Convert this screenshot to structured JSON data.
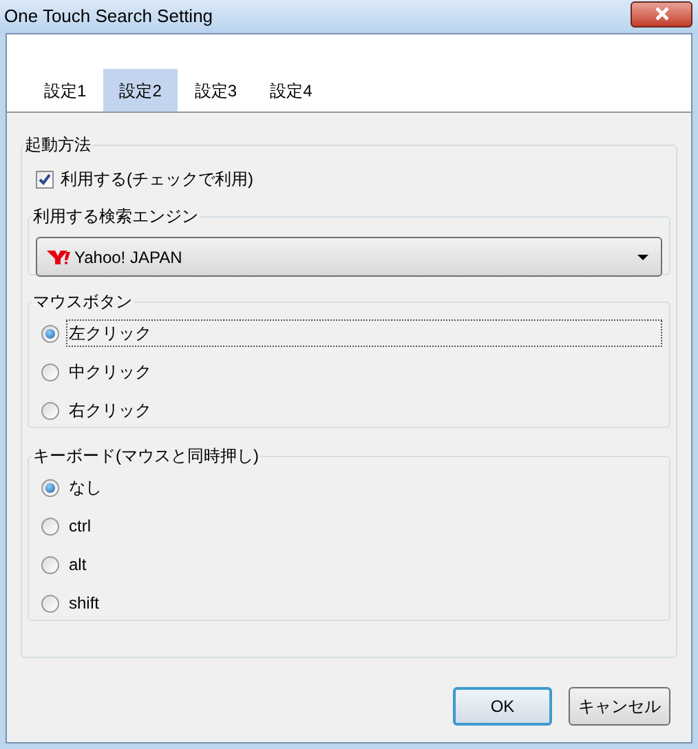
{
  "window": {
    "title": "One Touch Search Setting"
  },
  "tabs": [
    {
      "label": "設定1",
      "selected": false
    },
    {
      "label": "設定2",
      "selected": true
    },
    {
      "label": "設定3",
      "selected": false
    },
    {
      "label": "設定4",
      "selected": false
    }
  ],
  "startup": {
    "title": "起動方法",
    "enable": {
      "label": "利用する(チェックで利用)",
      "checked": true
    },
    "engine": {
      "title": "利用する検索エンジン",
      "value": "Yahoo! JAPAN"
    },
    "mouse": {
      "title": "マウスボタン",
      "options": [
        {
          "label": "左クリック",
          "selected": true,
          "focused": true
        },
        {
          "label": "中クリック",
          "selected": false,
          "focused": false
        },
        {
          "label": "右クリック",
          "selected": false,
          "focused": false
        }
      ]
    },
    "keyboard": {
      "title": "キーボード(マウスと同時押し)",
      "options": [
        {
          "label": "なし",
          "selected": true,
          "focused": false
        },
        {
          "label": "ctrl",
          "selected": false,
          "focused": false
        },
        {
          "label": "alt",
          "selected": false,
          "focused": false
        },
        {
          "label": "shift",
          "selected": false,
          "focused": false
        }
      ]
    }
  },
  "buttons": [
    {
      "label": "OK",
      "default": true
    },
    {
      "label": "キャンセル",
      "default": false
    }
  ]
}
